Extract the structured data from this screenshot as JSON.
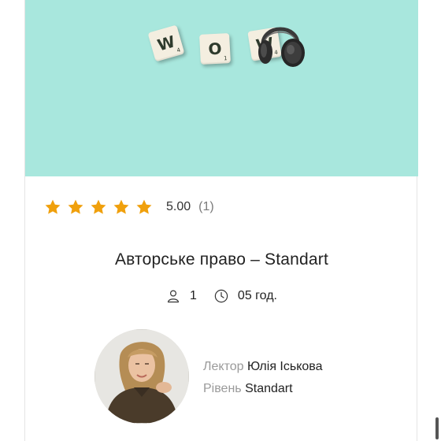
{
  "hero": {
    "tiles": [
      {
        "letter": "W",
        "points": "4"
      },
      {
        "letter": "O",
        "points": "1"
      },
      {
        "letter": "W",
        "points": "4"
      }
    ],
    "background_color": "#a8e7dd"
  },
  "rating": {
    "stars": 5,
    "star_color": "#f0a00c",
    "value": "5.00",
    "count": "(1)"
  },
  "course": {
    "title": "Авторське право – Standart",
    "students": "1",
    "duration": "05 год."
  },
  "lecturer": {
    "label": "Лектор",
    "name": "Юлія Іськова",
    "level_label": "Рівень",
    "level": "Standart"
  },
  "icons": {
    "students": "person-icon",
    "duration": "clock-icon",
    "rating": "star-icon"
  }
}
